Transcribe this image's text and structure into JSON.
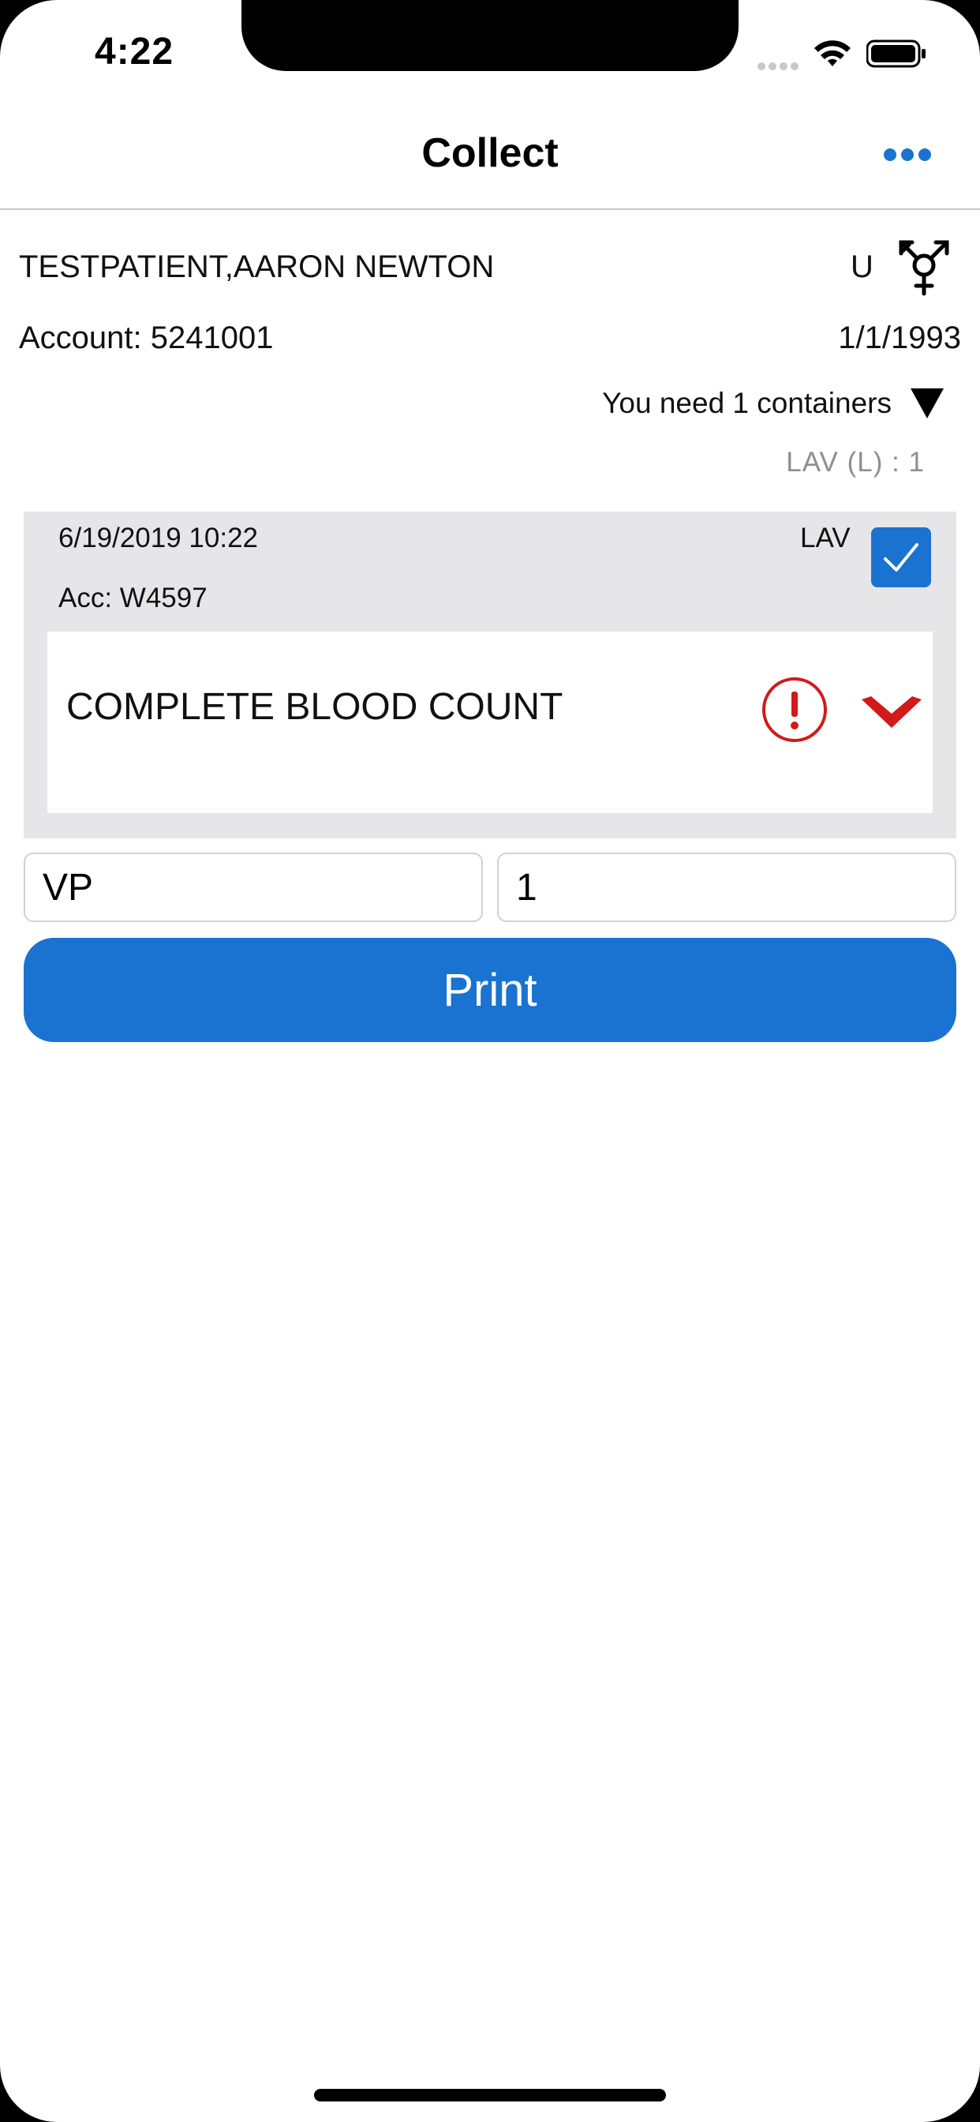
{
  "status_bar": {
    "time": "4:22",
    "icons": [
      "signal-icon",
      "wifi-icon",
      "battery-icon"
    ]
  },
  "nav": {
    "title": "Collect",
    "more_icon": "ellipsis-icon"
  },
  "patient": {
    "name": "TESTPATIENT,AARON NEWTON",
    "gender": "U",
    "gender_icon": "transgender-symbol-icon",
    "account": "Account: 5241001",
    "dob": "1/1/1993",
    "containers_needed": "You need 1 containers",
    "container_summary": "LAV  (L) : 1"
  },
  "order": {
    "datetime": "6/19/2019 10:22",
    "accession": "Acc: W4597",
    "container_type": "LAV",
    "selected": true,
    "test_name": "COMPLETE BLOOD COUNT",
    "warning_icon": "warning-circle-icon",
    "expand_icon": "chevron-down-icon"
  },
  "form": {
    "collector_value": "VP",
    "quantity_value": "1",
    "print_label": "Print"
  },
  "colors": {
    "accent": "#1a73d0",
    "warning": "#d21a1a",
    "card_bg": "#e6e6e9",
    "muted_text": "#8e8e93"
  }
}
